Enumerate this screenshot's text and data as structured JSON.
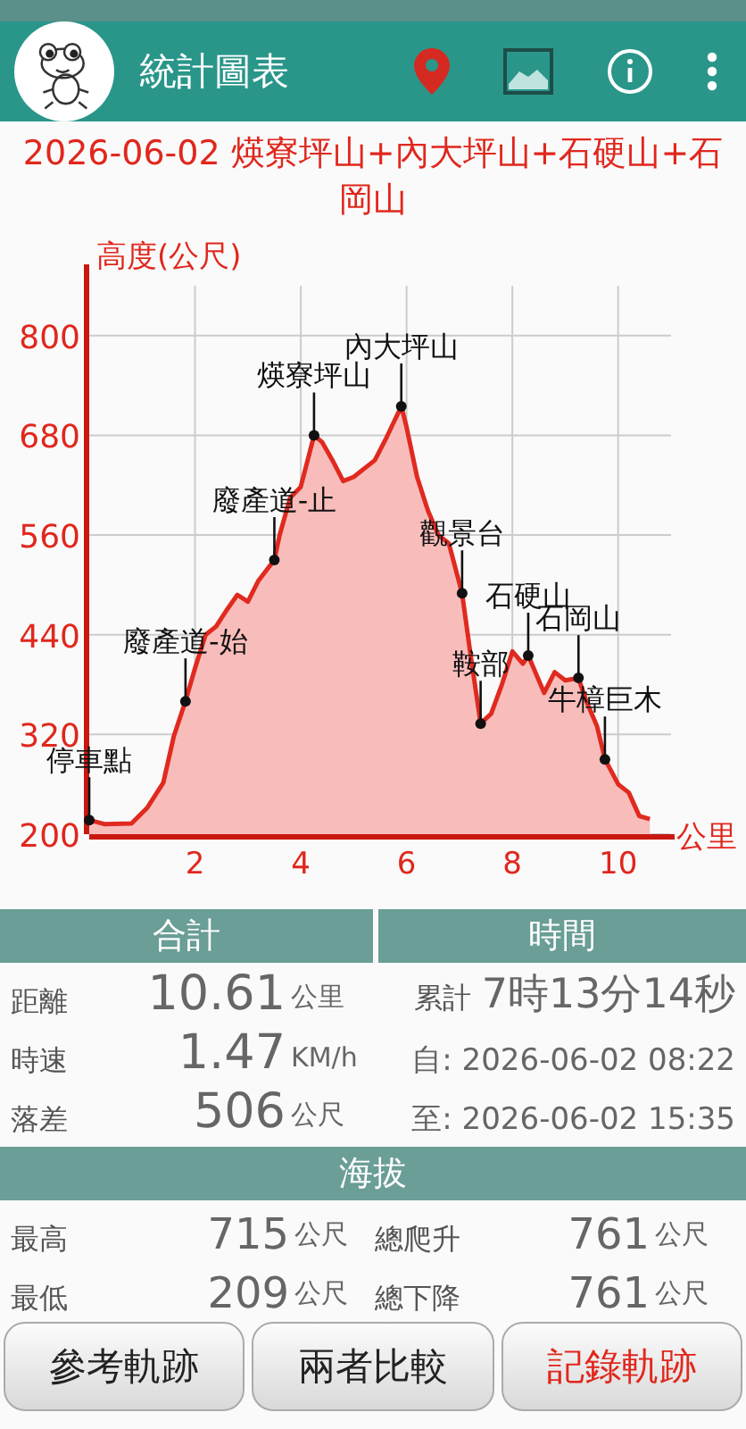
{
  "app_bar": {
    "title": "統計圖表"
  },
  "track_title": "2026-06-02 煐寮坪山+內大坪山+石硬山+石岡山",
  "chart": {
    "chart_data": {
      "type": "area",
      "grid": true,
      "ylabel": "高度(公尺)",
      "xlabel": "公里",
      "xlim": [
        0,
        11
      ],
      "ylim": [
        200,
        860
      ],
      "xticks": [
        2,
        4,
        6,
        8,
        10
      ],
      "yticks": [
        200,
        320,
        440,
        560,
        680,
        800
      ],
      "x": [
        0,
        0.3,
        0.8,
        1.1,
        1.4,
        1.6,
        1.82,
        2.0,
        2.2,
        2.4,
        2.6,
        2.8,
        3.0,
        3.2,
        3.5,
        3.6,
        3.8,
        4.0,
        4.25,
        4.4,
        4.6,
        4.8,
        5.0,
        5.2,
        5.4,
        5.6,
        5.9,
        6.0,
        6.2,
        6.4,
        6.6,
        6.8,
        7.05,
        7.2,
        7.4,
        7.6,
        7.8,
        8.0,
        8.2,
        8.3,
        8.6,
        8.8,
        9.0,
        9.25,
        9.4,
        9.6,
        9.75,
        10.0,
        10.2,
        10.4,
        10.6
      ],
      "series": [
        {
          "color": "#e02a20",
          "values": [
            217,
            212,
            213,
            232,
            262,
            318,
            360,
            400,
            440,
            450,
            470,
            488,
            480,
            505,
            530,
            560,
            605,
            618,
            680,
            672,
            650,
            625,
            630,
            640,
            650,
            675,
            715,
            690,
            630,
            590,
            560,
            550,
            490,
            420,
            333,
            345,
            380,
            420,
            405,
            415,
            370,
            395,
            385,
            388,
            360,
            330,
            290,
            260,
            250,
            222,
            218
          ]
        }
      ],
      "annotations": [
        {
          "text": "停車點",
          "x": 0,
          "y": 217
        },
        {
          "text": "廢產道-始",
          "x": 1.82,
          "y": 360
        },
        {
          "text": "廢產道-止",
          "x": 3.5,
          "y": 530
        },
        {
          "text": "煐寮坪山",
          "x": 4.25,
          "y": 680
        },
        {
          "text": "內大坪山",
          "x": 5.9,
          "y": 715
        },
        {
          "text": "觀景台",
          "x": 7.05,
          "y": 490
        },
        {
          "text": "鞍部",
          "x": 7.4,
          "y": 333
        },
        {
          "text": "石硬山",
          "x": 8.3,
          "y": 415
        },
        {
          "text": "石岡山",
          "x": 9.25,
          "y": 388
        },
        {
          "text": "牛樟巨木",
          "x": 9.75,
          "y": 290
        }
      ]
    }
  },
  "summary": {
    "headers": [
      "合計",
      "時間"
    ],
    "rows": [
      {
        "label": "距離",
        "value": "10.61",
        "unit": "公里",
        "time_label": "累計",
        "time_value": "7時13分14秒"
      },
      {
        "label": "時速",
        "value": "1.47",
        "unit": "KM/h",
        "time_value": "自: 2026-06-02 08:22"
      },
      {
        "label": "落差",
        "value": "506",
        "unit": "公尺",
        "time_value": "至: 2026-06-02 15:35"
      }
    ]
  },
  "elevation": {
    "header": "海拔",
    "rows": [
      {
        "label": "最高",
        "value": "715",
        "unit": "公尺",
        "label2": "總爬升",
        "value2": "761",
        "unit2": "公尺"
      },
      {
        "label": "最低",
        "value": "209",
        "unit": "公尺",
        "label2": "總下降",
        "value2": "761",
        "unit2": "公尺"
      }
    ]
  },
  "buttons": [
    {
      "label": "參考軌跡",
      "kind": "normal"
    },
    {
      "label": "兩者比較",
      "kind": "normal"
    },
    {
      "label": "記錄軌跡",
      "kind": "record"
    }
  ]
}
